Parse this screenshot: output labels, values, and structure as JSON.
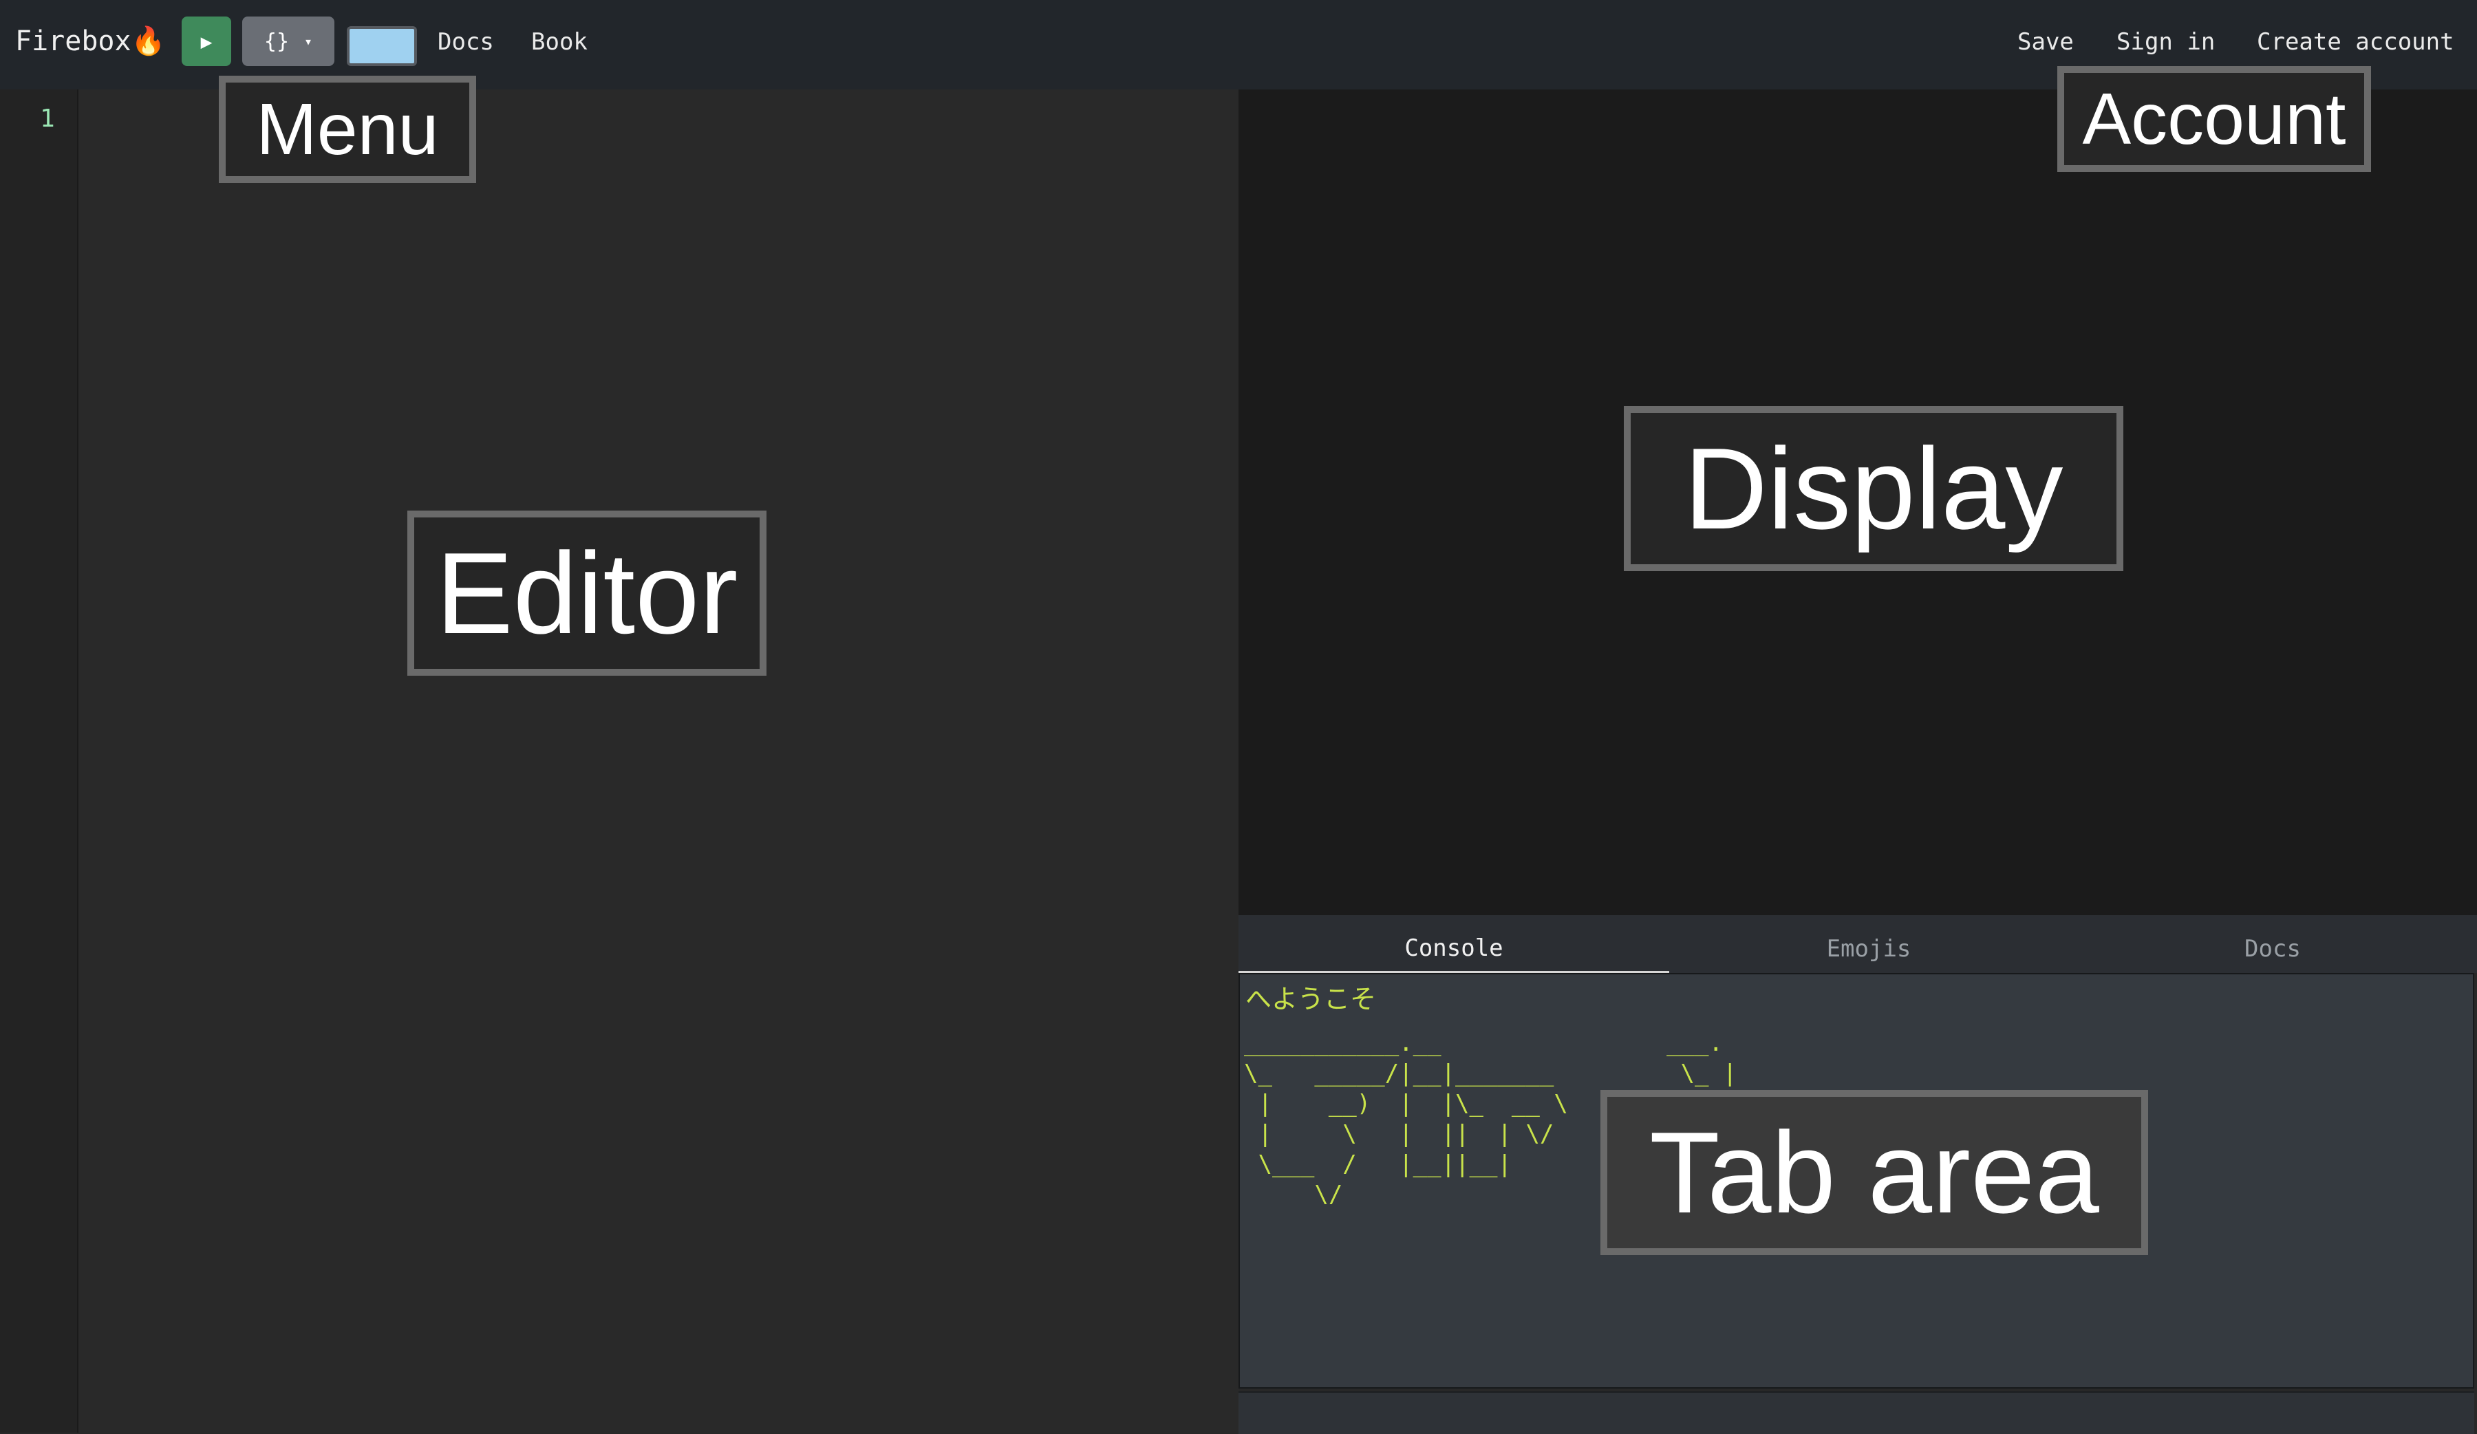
{
  "topbar": {
    "brand": "Firebox",
    "brand_icon": "🔥",
    "run_label": "▶",
    "format_label": "{}",
    "format_caret": "▾",
    "color_swatch": "#9fd1f0",
    "links": {
      "docs": "Docs",
      "book": "Book"
    },
    "account": {
      "save": "Save",
      "sign_in": "Sign in",
      "create_account": "Create account"
    }
  },
  "editor": {
    "line_number": "1"
  },
  "tabs": {
    "console": "Console",
    "emojis": "Emojis",
    "docs": "Docs",
    "active": "Console"
  },
  "console": {
    "welcome": "へようこそ",
    "ascii_art": "___________.__                ___.\n\\_   _____/|__|_______         \\_ |\n |    __)  |  |\\_  __ \\         | |\n |     \\   |  ||  | \\/          | |\n \\___  /   |__||__|             |_|\n     \\/                         \\/        \\/"
  },
  "overlay_labels": {
    "menu": "Menu",
    "account": "Account",
    "editor": "Editor",
    "display": "Display",
    "tab_area": "Tab area"
  },
  "colors": {
    "run_button": "#3f8a5b",
    "console_text": "#c9e34a",
    "line_number": "#9be7b4"
  }
}
